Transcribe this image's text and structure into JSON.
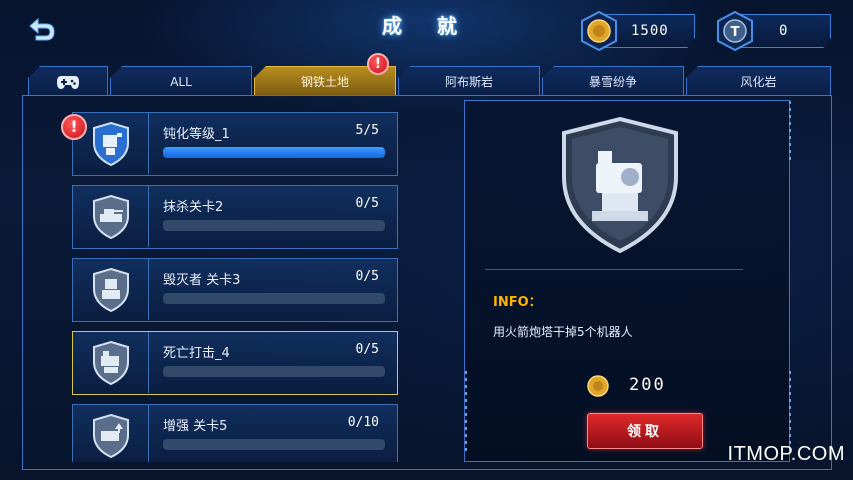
{
  "header": {
    "title": "成 就",
    "coins": "1500",
    "tokens": "0"
  },
  "tabs": [
    {
      "label": "",
      "icon": "gamepad-icon"
    },
    {
      "label": "ALL"
    },
    {
      "label": "钢铁土地",
      "active": true,
      "alert": "!"
    },
    {
      "label": "阿布斯岩"
    },
    {
      "label": "暴雪纷争"
    },
    {
      "label": "风化岩"
    }
  ],
  "achievements": [
    {
      "name": "钝化等级_1",
      "progress": "5/5",
      "fraction": 1.0,
      "alert": "!"
    },
    {
      "name": "抹杀关卡2",
      "progress": "0/5",
      "fraction": 0
    },
    {
      "name": "毁灭者 关卡3",
      "progress": "0/5",
      "fraction": 0
    },
    {
      "name": "死亡打击_4",
      "progress": "0/5",
      "fraction": 0,
      "selected": true
    },
    {
      "name": "增强 关卡5",
      "progress": "0/10",
      "fraction": 0
    }
  ],
  "detail": {
    "info_label": "INFO：",
    "info_text": "用火箭炮塔干掉5个机器人",
    "reward": "200",
    "claim_label": "领取"
  },
  "watermark": "ITMOP.COM",
  "colors": {
    "accent": "#3a74c8",
    "active_tab": "#b88d1f",
    "progress": "#1e7bff",
    "alert": "#d0141f",
    "claim": "#c41e24"
  }
}
